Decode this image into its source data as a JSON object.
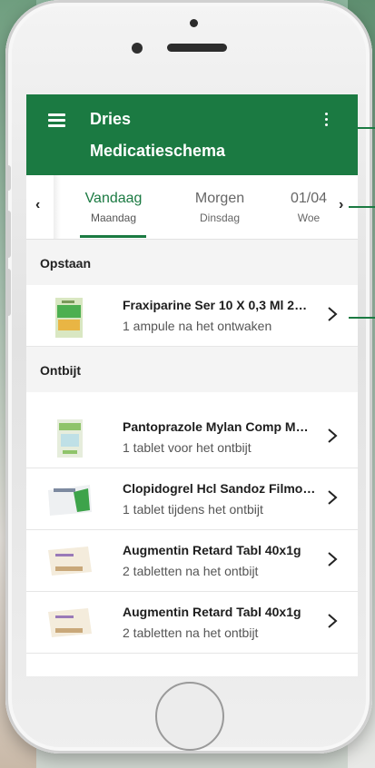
{
  "app": {
    "user_name": "Dries",
    "screen_title": "Medicatieschema"
  },
  "icons": {
    "menu": "hamburger-menu-icon",
    "more": "kebab-menu-icon",
    "prev": "chevron-left-icon",
    "next": "chevron-right-icon",
    "item_chevron": "chevron-right-icon"
  },
  "colors": {
    "brand": "#1b7a42",
    "section_bg": "#f4f4f4",
    "text_primary": "#1d1d1d",
    "text_secondary": "#555555"
  },
  "days": [
    {
      "label": "Vandaag",
      "weekday": "Maandag",
      "active": true
    },
    {
      "label": "Morgen",
      "weekday": "Dinsdag",
      "active": false
    },
    {
      "label": "01/04",
      "weekday": "Woe",
      "active": false
    }
  ],
  "nav": {
    "prev_glyph": "‹",
    "next_glyph": "›"
  },
  "sections": [
    {
      "title": "Opstaan",
      "items": [
        {
          "name": "Fraxiparine Ser 10 X 0,3 Ml 2…",
          "instruction": "1 ampule na het ontwaken"
        }
      ]
    },
    {
      "title": "Ontbijt",
      "items": [
        {
          "name": "Pantoprazole Mylan Comp M…",
          "instruction": "1 tablet voor het ontbijt"
        },
        {
          "name": "Clopidogrel Hcl Sandoz Filmo…",
          "instruction": "1 tablet tijdens het ontbijt"
        },
        {
          "name": "Augmentin Retard Tabl 40x1g",
          "instruction": "2 tabletten na het ontbijt"
        },
        {
          "name": "Augmentin Retard Tabl 40x1g",
          "instruction": "2 tabletten na het ontbijt"
        }
      ]
    }
  ]
}
